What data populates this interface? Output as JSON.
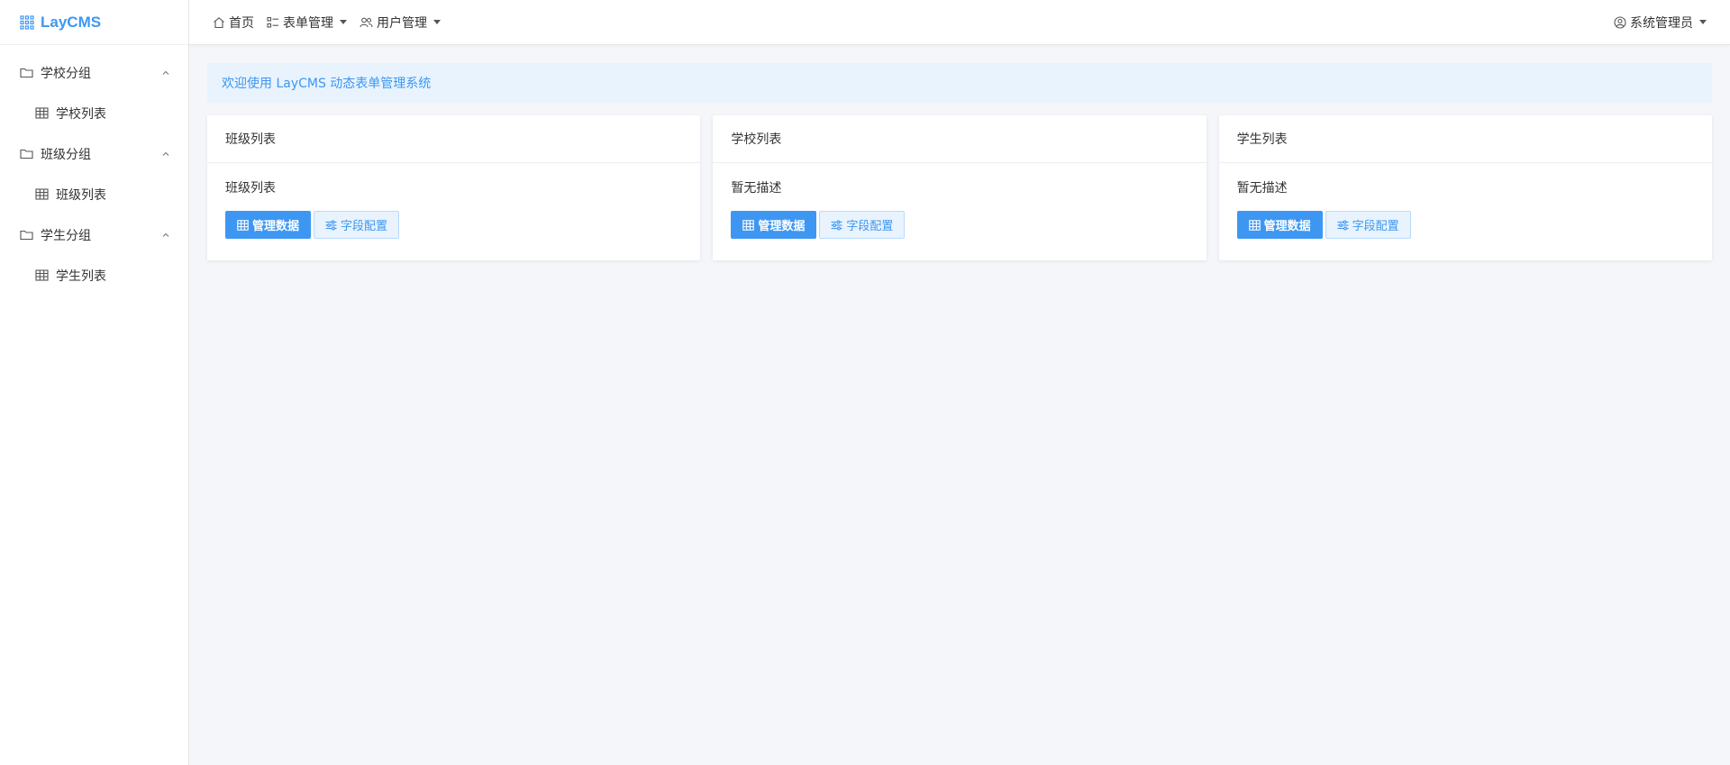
{
  "app": {
    "brand": "LayCMS"
  },
  "colors": {
    "accent": "#3d97f2",
    "accent_light": "#e8f3fe",
    "background": "#f4f6fa"
  },
  "topnav": {
    "home": {
      "label": "首页",
      "icon": "home-icon"
    },
    "forms": {
      "label": "表单管理",
      "icon": "list-icon"
    },
    "users": {
      "label": "用户管理",
      "icon": "users-icon"
    },
    "account": {
      "label": "系统管理员",
      "icon": "user-circle-icon"
    }
  },
  "sidebar": {
    "groups": [
      {
        "label": "学校分组",
        "items": [
          {
            "label": "学校列表"
          }
        ]
      },
      {
        "label": "班级分组",
        "items": [
          {
            "label": "班级列表"
          }
        ]
      },
      {
        "label": "学生分组",
        "items": [
          {
            "label": "学生列表"
          }
        ]
      }
    ]
  },
  "welcome": "欢迎使用 LayCMS 动态表单管理系统",
  "cards": [
    {
      "title": "班级列表",
      "desc": "班级列表",
      "manage_label": "管理数据",
      "fields_label": "字段配置"
    },
    {
      "title": "学校列表",
      "desc": "暂无描述",
      "manage_label": "管理数据",
      "fields_label": "字段配置"
    },
    {
      "title": "学生列表",
      "desc": "暂无描述",
      "manage_label": "管理数据",
      "fields_label": "字段配置"
    }
  ]
}
